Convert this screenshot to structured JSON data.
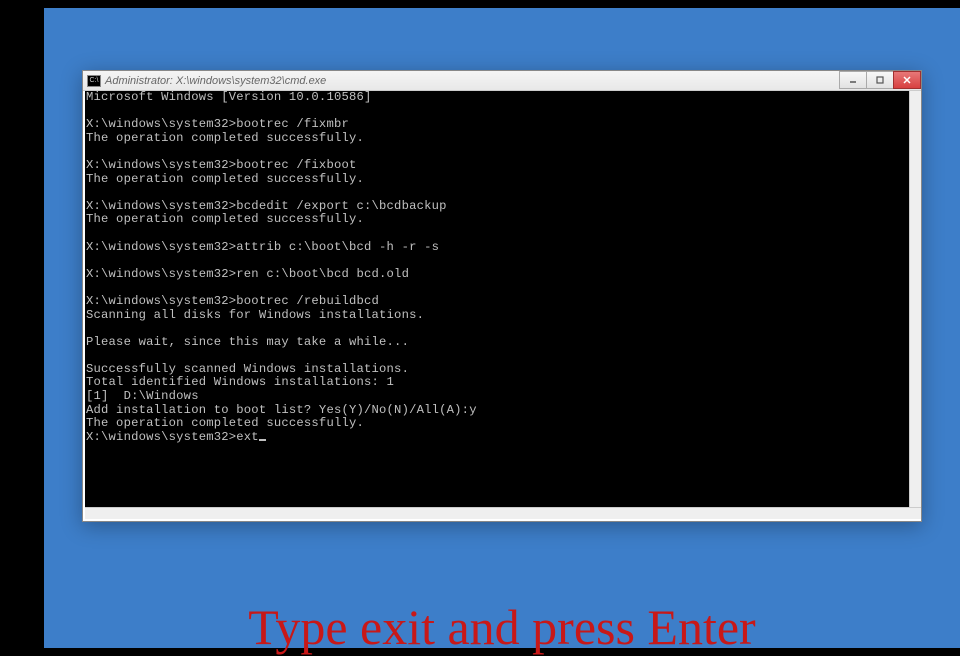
{
  "window": {
    "title": "Administrator: X:\\windows\\system32\\cmd.exe",
    "icon_glyph": "C:\\"
  },
  "terminal": {
    "header": "Microsoft Windows [Version 10.0.10586]",
    "blocks": [
      {
        "prompt": "X:\\windows\\system32>",
        "command": "bootrec /fixmbr",
        "output": [
          "The operation completed successfully."
        ]
      },
      {
        "prompt": "X:\\windows\\system32>",
        "command": "bootrec /fixboot",
        "output": [
          "The operation completed successfully."
        ]
      },
      {
        "prompt": "X:\\windows\\system32>",
        "command": "bcdedit /export c:\\bcdbackup",
        "output": [
          "The operation completed successfully."
        ]
      },
      {
        "prompt": "X:\\windows\\system32>",
        "command": "attrib c:\\boot\\bcd -h -r -s",
        "output": []
      },
      {
        "prompt": "X:\\windows\\system32>",
        "command": "ren c:\\boot\\bcd bcd.old",
        "output": []
      },
      {
        "prompt": "X:\\windows\\system32>",
        "command": "bootrec /rebuildbcd",
        "output": [
          "Scanning all disks for Windows installations.",
          "",
          "Please wait, since this may take a while...",
          "",
          "Successfully scanned Windows installations.",
          "Total identified Windows installations: 1",
          "[1]  D:\\Windows",
          "Add installation to boot list? Yes(Y)/No(N)/All(A):y",
          "The operation completed successfully."
        ]
      }
    ],
    "current": {
      "prompt": "X:\\windows\\system32>",
      "typed": "ext"
    }
  },
  "caption": "Type exit and press Enter"
}
